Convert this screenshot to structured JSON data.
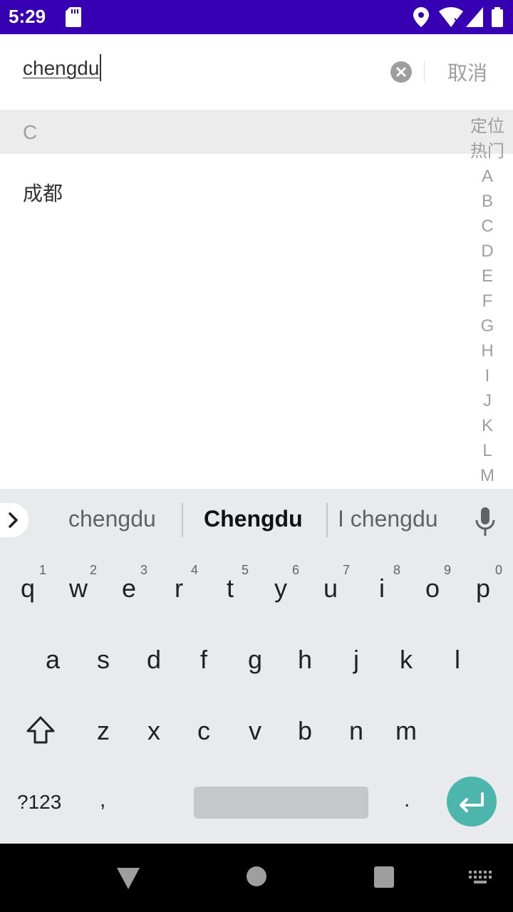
{
  "status_bar": {
    "time": "5:29",
    "bg_color": "#3700b3",
    "icons": [
      "sd-card-icon",
      "location-icon",
      "wifi-icon",
      "signal-icon",
      "battery-icon"
    ]
  },
  "search": {
    "value": "chengdu",
    "cancel_label": "取消"
  },
  "results": {
    "section_letter": "C",
    "items": [
      "成都"
    ]
  },
  "index_bar": [
    "定位",
    "热门",
    "A",
    "B",
    "C",
    "D",
    "E",
    "F",
    "G",
    "H",
    "I",
    "J",
    "K",
    "L",
    "M"
  ],
  "keyboard": {
    "suggestions": [
      "chengdu",
      "Chengdu",
      "I chengdu"
    ],
    "row1": [
      {
        "key": "q",
        "hint": "1"
      },
      {
        "key": "w",
        "hint": "2"
      },
      {
        "key": "e",
        "hint": "3"
      },
      {
        "key": "r",
        "hint": "4"
      },
      {
        "key": "t",
        "hint": "5"
      },
      {
        "key": "y",
        "hint": "6"
      },
      {
        "key": "u",
        "hint": "7"
      },
      {
        "key": "i",
        "hint": "8"
      },
      {
        "key": "o",
        "hint": "9"
      },
      {
        "key": "p",
        "hint": "0"
      }
    ],
    "row2": [
      "a",
      "s",
      "d",
      "f",
      "g",
      "h",
      "j",
      "k",
      "l"
    ],
    "row3": [
      "z",
      "x",
      "c",
      "v",
      "b",
      "n",
      "m"
    ],
    "symbols_label": "?123",
    "comma_label": ",",
    "period_label": ".",
    "enter_color": "#4db6ac"
  }
}
